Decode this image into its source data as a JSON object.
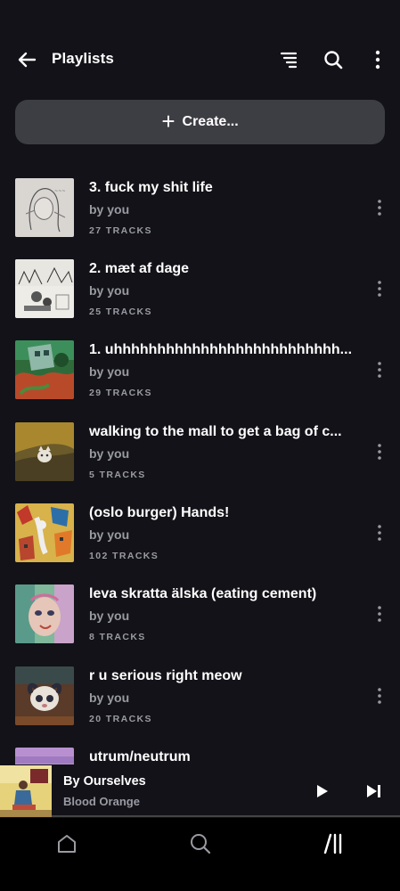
{
  "header": {
    "back_icon": "arrow-left-icon",
    "title": "Playlists",
    "sort_icon": "sort-lines-icon",
    "search_icon": "search-icon",
    "more_icon": "more-vertical-icon"
  },
  "create": {
    "icon": "plus-icon",
    "plus_glyph": "+",
    "label": "Create..."
  },
  "playlists": [
    {
      "title": "3. fuck my shit life",
      "owner": "by you",
      "tracks": "27 TRACKS"
    },
    {
      "title": "2. mæt af dage",
      "owner": "by you",
      "tracks": "25 TRACKS"
    },
    {
      "title": "1. uhhhhhhhhhhhhhhhhhhhhhhhhhh...",
      "owner": "by you",
      "tracks": "29 TRACKS"
    },
    {
      "title": "walking to the mall to get a bag of c...",
      "owner": "by you",
      "tracks": "5 TRACKS"
    },
    {
      "title": "(oslo burger) Hands!",
      "owner": "by you",
      "tracks": "102 TRACKS"
    },
    {
      "title": "leva skratta älska (eating cement)",
      "owner": "by you",
      "tracks": "8 TRACKS"
    },
    {
      "title": "r u serious right meow",
      "owner": "by you",
      "tracks": "20 TRACKS"
    },
    {
      "title": "utrum/neutrum",
      "owner": "",
      "tracks": ""
    }
  ],
  "now_playing": {
    "title": "By Ourselves",
    "artist": "Blood Orange",
    "play_icon": "play-icon",
    "next_icon": "skip-next-icon"
  },
  "tabs": [
    {
      "name": "home",
      "icon": "home-icon"
    },
    {
      "name": "search",
      "icon": "search-icon"
    },
    {
      "name": "library",
      "icon": "library-icon"
    }
  ],
  "colors": {
    "background": "#121218",
    "create_button": "#3d3d44",
    "secondary_text": "#9a9aa2",
    "tab_bar": "#000000"
  }
}
